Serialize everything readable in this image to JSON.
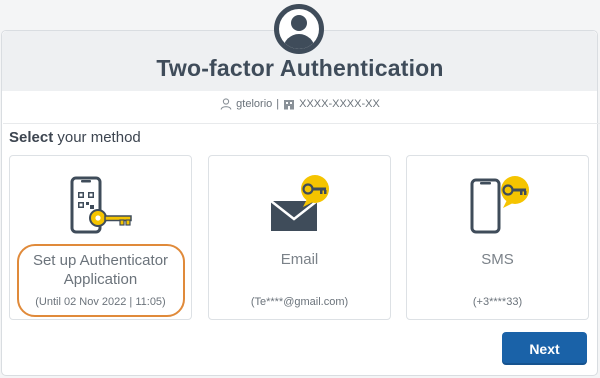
{
  "dialog": {
    "title": "Two-factor Authentication",
    "username": "gtelorio",
    "separator": "|",
    "account_id": "XXXX-XXXX-XX",
    "select_prefix": "Select",
    "select_suffix": " your method"
  },
  "methods": [
    {
      "title_line1": "Set up Authenticator",
      "title_line2": "Application",
      "detail": "(Until 02 Nov 2022 | 11:05)",
      "icon": "phone-qr-key-icon",
      "highlighted": true
    },
    {
      "title_line1": "Email",
      "detail": "(Te****@gmail.com)",
      "icon": "envelope-key-icon",
      "highlighted": false
    },
    {
      "title_line1": "SMS",
      "detail": "(+3****33)",
      "icon": "phone-key-icon",
      "highlighted": false
    }
  ],
  "actions": {
    "next_label": "Next"
  },
  "colors": {
    "accent": "#1a62a8",
    "key_gold": "#f5c400",
    "dark_slate": "#3f4c5a",
    "highlight_orange": "#e08a3a"
  }
}
